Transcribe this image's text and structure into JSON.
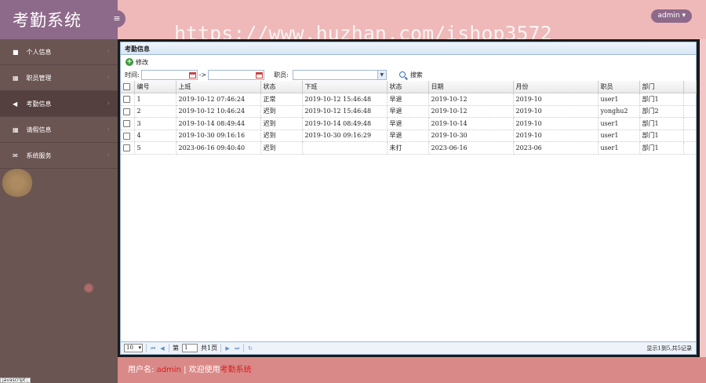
{
  "app": {
    "title": "考勤系统",
    "user": "admin"
  },
  "watermark": "https://www.huzhan.com/ishop3572",
  "sidebar": {
    "items": [
      {
        "label": "个人信息",
        "icon": "book-icon"
      },
      {
        "label": "职员管理",
        "icon": "grid-icon"
      },
      {
        "label": "考勤信息",
        "icon": "megaphone-icon",
        "active": true
      },
      {
        "label": "请假信息",
        "icon": "grid-icon"
      },
      {
        "label": "系统服务",
        "icon": "envelope-icon"
      }
    ]
  },
  "panel": {
    "title": "考勤信息",
    "edit_label": "修改",
    "filter": {
      "time_label": "时间:",
      "arrow": "->",
      "employee_label": "职员:",
      "search_label": "搜索"
    }
  },
  "table": {
    "columns": [
      "编号",
      "上班",
      "状态",
      "下班",
      "状态",
      "日期",
      "月份",
      "职员",
      "部门"
    ],
    "rows": [
      [
        "1",
        "2019-10-12 07:46:24",
        "正常",
        "2019-10-12 15:46:48",
        "早退",
        "2019-10-12",
        "2019-10",
        "user1",
        "部门1"
      ],
      [
        "2",
        "2019-10-12 10:46:24",
        "迟到",
        "2019-10-12 15:46:48",
        "早退",
        "2019-10-12",
        "2019-10",
        "yonghu2",
        "部门2"
      ],
      [
        "3",
        "2019-10-14 08:49:44",
        "迟到",
        "2019-10-14 08:49:48",
        "早退",
        "2019-10-14",
        "2019-10",
        "user1",
        "部门1"
      ],
      [
        "4",
        "2019-10-30 09:16:16",
        "迟到",
        "2019-10-30 09:16:29",
        "早退",
        "2019-10-30",
        "2019-10",
        "user1",
        "部门1"
      ],
      [
        "5",
        "2023-06-16 09:40:40",
        "迟到",
        "",
        "未打",
        "2023-06-16",
        "2023-06",
        "user1",
        "部门1"
      ]
    ]
  },
  "pager": {
    "page_size": "10",
    "page_prefix": "第",
    "page_value": "1",
    "page_suffix": "共1页",
    "info": "显示1到5,共5记录"
  },
  "footer": {
    "prefix": "用户名:",
    "user": "admin",
    "sep": "| 欢迎使用",
    "system": "考勤系统"
  },
  "status_bar": "javascript:;"
}
